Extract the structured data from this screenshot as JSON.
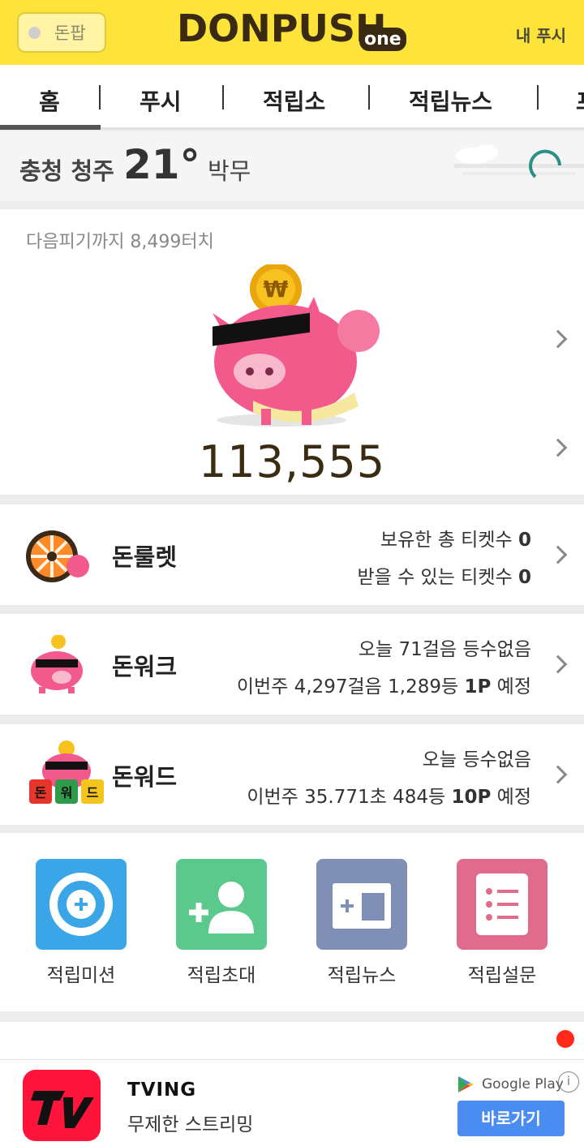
{
  "header": {
    "tip_label": "돈팝",
    "logo_text": "DONPUSH",
    "logo_suffix": "one",
    "my_push": "내 푸시"
  },
  "tabs": [
    {
      "label": "홈",
      "active": true
    },
    {
      "label": "푸시"
    },
    {
      "label": "적립소"
    },
    {
      "label": "적립뉴스"
    },
    {
      "label": "프"
    }
  ],
  "weather": {
    "location": "충청 청주",
    "temperature": "21°",
    "condition": "박무"
  },
  "piggy": {
    "next_info": "다음피기까지 8,499터치",
    "coin_symbol": "₩",
    "total": "113,555"
  },
  "games": [
    {
      "title": "돈룰렛",
      "line1": [
        "보유한 총 티켓수 ",
        "0",
        ""
      ],
      "line2": [
        "받을 수 있는 티켓수 ",
        "0",
        ""
      ]
    },
    {
      "title": "돈워크",
      "line1": [
        "오늘 71걸음 등수없음",
        "",
        ""
      ],
      "line2": [
        "이번주 4,297걸음 1,289등 ",
        "1P",
        " 예정"
      ]
    },
    {
      "title": "돈워드",
      "line1": [
        "오늘 등수없음",
        "",
        ""
      ],
      "line2": [
        "이번주 35.771초 484등 ",
        "10P",
        " 예정"
      ],
      "blocks": [
        "돈",
        "워",
        "드"
      ]
    }
  ],
  "shortcuts": [
    {
      "label": "적립미션",
      "color": "#3aa6e8"
    },
    {
      "label": "적립초대",
      "color": "#5ac98b"
    },
    {
      "label": "적립뉴스",
      "color": "#7f8fb5"
    },
    {
      "label": "적립설문",
      "color": "#e06b8c"
    }
  ],
  "ad": {
    "title": "TVING",
    "subtitle": "무제한 스트리밍",
    "store": "Google Play",
    "info": "i",
    "button": "바로가기"
  }
}
